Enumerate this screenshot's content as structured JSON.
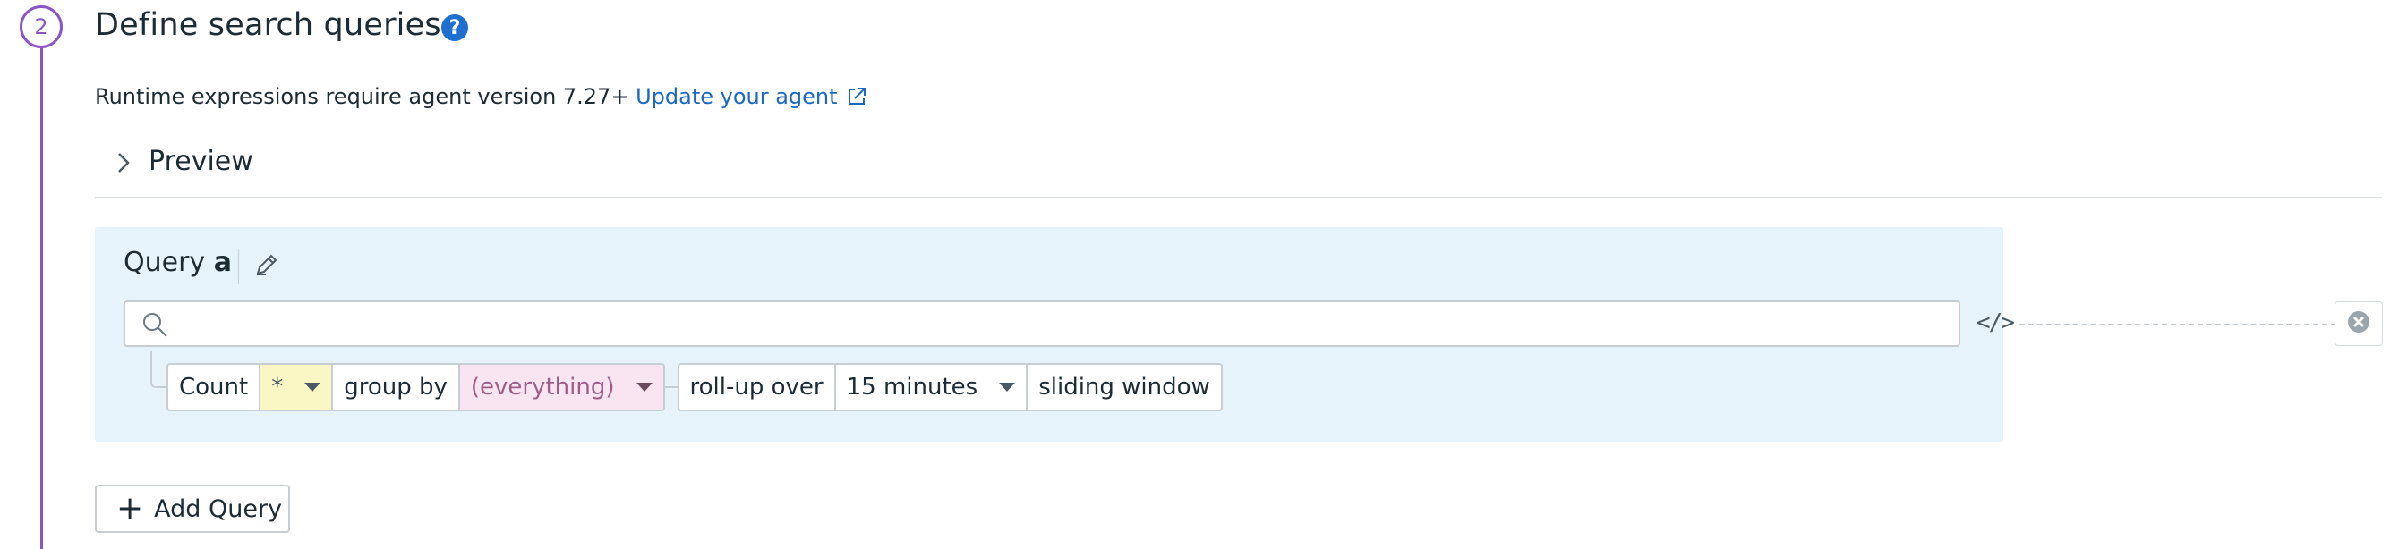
{
  "step": {
    "number": "2",
    "title": "Define search queries"
  },
  "runtime_notice": {
    "text": "Runtime expressions require agent version 7.27+ ",
    "link_text": "Update your agent"
  },
  "preview": {
    "label": "Preview"
  },
  "query": {
    "title_prefix": "Query ",
    "letter": "a",
    "search": {
      "value": "",
      "placeholder": ""
    },
    "chips": {
      "aggregation": "Count",
      "measure": "*",
      "group_by_label": "group by",
      "group_by_value": "(everything)",
      "rollup_label": "roll-up over",
      "rollup_value": "15 minutes",
      "window_label": "sliding window"
    }
  },
  "add_query": {
    "label": "Add Query"
  },
  "colors": {
    "accent": "#8b56c3",
    "link": "#1a67c4",
    "panel": "#e7f3fb",
    "measure_chip": "#fbf7c5",
    "group_chip": "#f9e4f2"
  },
  "icons": [
    "help-icon",
    "external-link-icon",
    "chevron-right-icon",
    "pencil-icon",
    "search-icon",
    "code-icon",
    "remove-icon",
    "plus-icon",
    "caret-down-icon"
  ]
}
